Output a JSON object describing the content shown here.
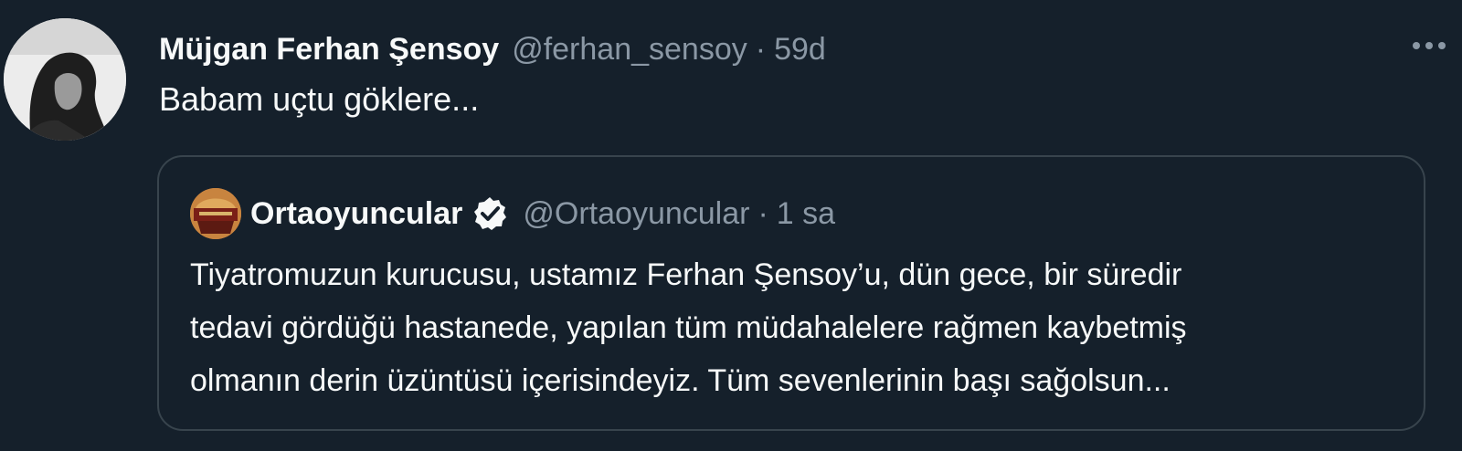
{
  "tweet": {
    "author": {
      "display_name": "Müjgan Ferhan Şensoy",
      "handle": "@ferhan_sensoy",
      "avatar_icon": "profile-photo-avatar"
    },
    "separator": "·",
    "time": "59d",
    "text": "Babam uçtu göklere...",
    "more_icon": "more-horizontal-icon"
  },
  "quoted_tweet": {
    "author": {
      "display_name": "Ortaoyuncular",
      "handle": "@Ortaoyuncular",
      "verified": true,
      "avatar_icon": "theatre-logo-avatar"
    },
    "separator": "·",
    "time": "1 sa",
    "text_lines": [
      "Tiyatromuzun kurucusu, ustamız Ferhan Şensoy’u, dün gece, bir süredir",
      "tedavi gördüğü hastanede, yapılan tüm müdahalelere rağmen kaybetmiş",
      "olmanın derin üzüntüsü içerisindeyiz. Tüm sevenlerinin başı sağolsun..."
    ]
  },
  "colors": {
    "background": "#15202b",
    "primary_text": "#f7f9f9",
    "secondary_text": "#8b98a5",
    "border": "#38444d"
  }
}
